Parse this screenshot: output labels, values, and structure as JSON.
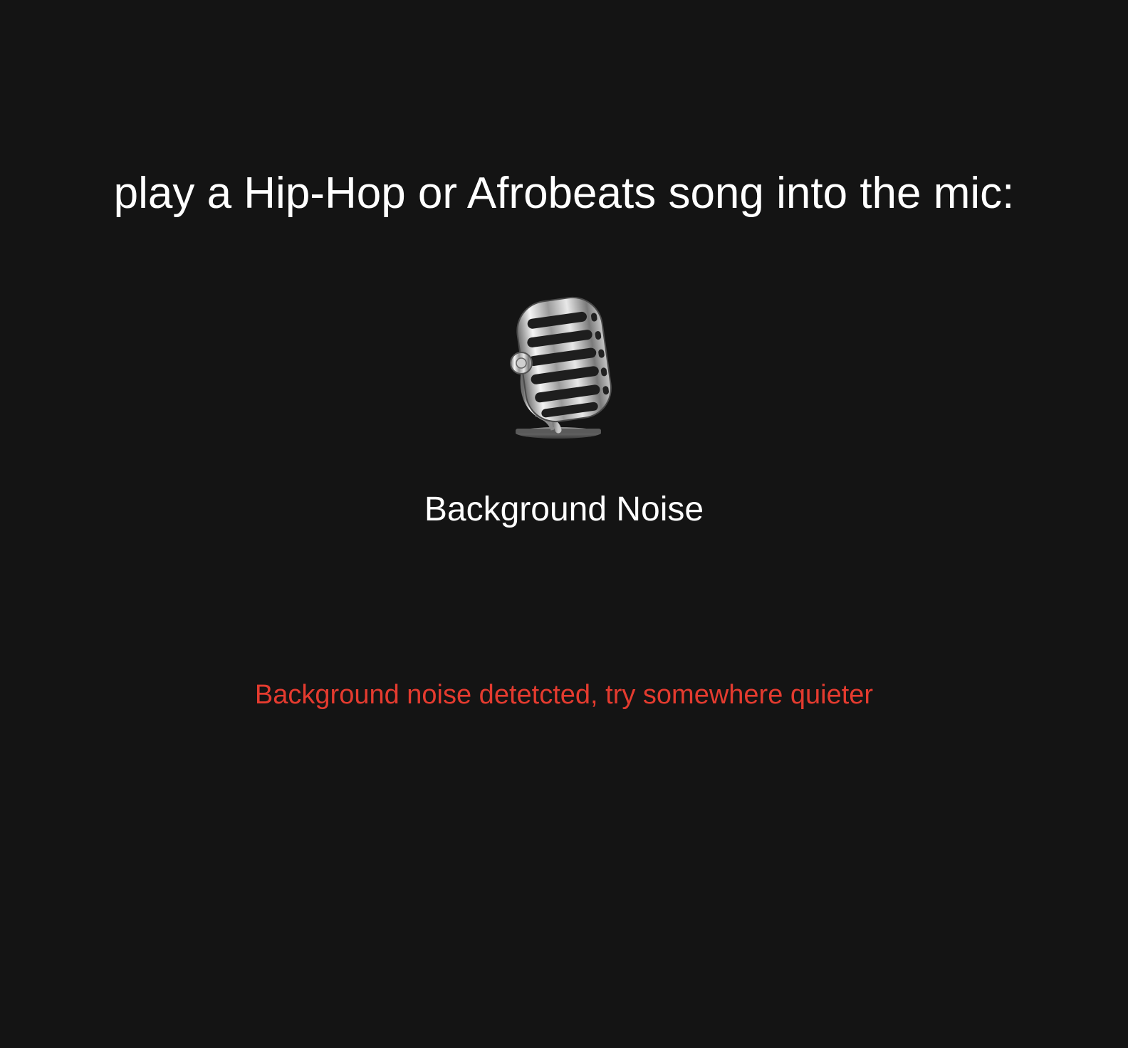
{
  "instruction": "play a Hip-Hop or Afrobeats song into the mic:",
  "mic": {
    "icon": "studio-microphone-icon"
  },
  "status": {
    "label": "Background Noise"
  },
  "warning": {
    "text": "Background noise detetcted, try somewhere quieter",
    "color": "#e43b2f"
  },
  "colors": {
    "background": "#141414",
    "text": "#ffffff"
  }
}
